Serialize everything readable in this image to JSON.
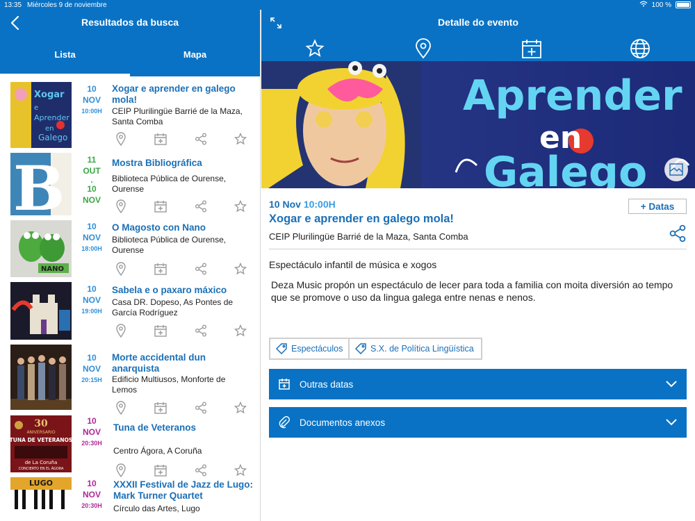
{
  "status": {
    "time": "13:35",
    "date": "Miércoles 9 de noviembre",
    "battery": "100 %"
  },
  "left": {
    "title": "Resultados da busca",
    "tabs": [
      "Lista",
      "Mapa"
    ],
    "items": [
      {
        "day": "10",
        "month": "NOV",
        "time": "10:00H",
        "title": "Xogar e aprender en galego mola!",
        "place": "CEIP Plurilingüe Barrié de la Maza, Santa Comba",
        "color": "#2e8fd8"
      },
      {
        "day": "11",
        "month": "OUT",
        "day2": "10",
        "month2": "NOV",
        "title": "Mostra Bibliográfica",
        "place": "Biblioteca Pública de Ourense, Ourense",
        "color": "#3aa845"
      },
      {
        "day": "10",
        "month": "NOV",
        "time": "18:00H",
        "title": "O Magosto con Nano",
        "place": "Biblioteca Pública de Ourense, Ourense",
        "color": "#2e8fd8"
      },
      {
        "day": "10",
        "month": "NOV",
        "time": "19:00H",
        "title": "Sabela e o paxaro máxico",
        "place": "Casa DR. Dopeso, As Pontes de García Rodríguez",
        "color": "#2e8fd8"
      },
      {
        "day": "10",
        "month": "NOV",
        "time": "20:15H",
        "title": "Morte accidental dun anarquista",
        "place": "Edificio Multiusos, Monforte de Lemos",
        "color": "#2e8fd8"
      },
      {
        "day": "10",
        "month": "NOV",
        "time": "20:30H",
        "title": "Tuna de Veteranos",
        "place": "Centro Ágora, A Coruña",
        "color": "#b0279a"
      },
      {
        "day": "10",
        "month": "NOV",
        "time": "20:30H",
        "title": "XXXII Festival de Jazz de Lugo: Mark Turner Quartet",
        "place": "Círculo das Artes, Lugo",
        "color": "#b0279a"
      }
    ],
    "thumb_texts": {
      "t2_letter": "B",
      "t3_text": "NANO",
      "t6_top": "30",
      "t6_line1": "ANIVERSARIO",
      "t6_line2": "TUNA DE VETERANOS",
      "t6_line3": "de La Coruña",
      "t6_line4": "CONCIERTO EN EL ÁGORA",
      "t7_text": "LUGO"
    }
  },
  "right": {
    "title": "Detalle do evento",
    "hero_text": {
      "line1": "Aprender",
      "line2": "en",
      "line3": "Galego"
    },
    "date": "10 Nov",
    "time": "10:00H",
    "more_dates": "+ Datas",
    "event_title": "Xogar e aprender en galego mola!",
    "place": "CEIP Plurilingüe Barrié de la Maza, Santa Comba",
    "subtitle": "Espectáculo infantil de música e xogos",
    "description": "Deza Music propón un espectáculo de lecer para toda a familia con moita diversión ao tempo que se promove o uso da lingua galega entre nenas e nenos.",
    "tags": [
      "Espectáculos",
      "S.X. de Política Lingüística"
    ],
    "sections": [
      "Outras datas",
      "Documentos anexos"
    ]
  }
}
